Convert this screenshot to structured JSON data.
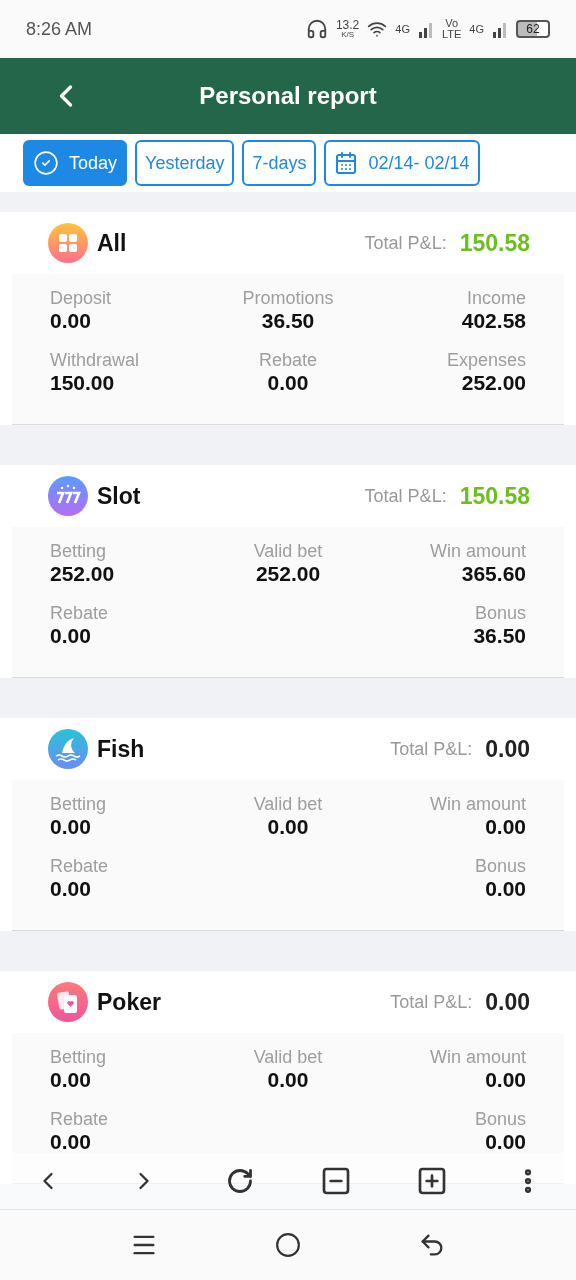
{
  "status_bar": {
    "time": "8:26 AM",
    "speed_value": "13.2",
    "speed_unit": "K/S",
    "network_1": "4G",
    "volte_top": "Vo",
    "volte_bottom": "LTE",
    "network_2": "4G",
    "battery": "62"
  },
  "header": {
    "title": "Personal report"
  },
  "filters": [
    {
      "kind": "preset",
      "label": "Today",
      "selected": true
    },
    {
      "kind": "preset",
      "label": "Yesterday",
      "selected": false
    },
    {
      "kind": "preset",
      "label": "7-days",
      "selected": false
    },
    {
      "kind": "date_range",
      "label": "02/14- 02/14",
      "selected": false
    }
  ],
  "cards": [
    {
      "name": "All",
      "kind": "grid",
      "total_label": "Total P&L:",
      "total": "150.58",
      "positive": true,
      "rows": [
        [
          {
            "label": "Deposit",
            "value": "0.00"
          },
          {
            "label": "Promotions",
            "value": "36.50"
          },
          {
            "label": "Income",
            "value": "402.58"
          }
        ],
        [
          {
            "label": "Withdrawal",
            "value": "150.00"
          },
          {
            "label": "Rebate",
            "value": "0.00"
          },
          {
            "label": "Expenses",
            "value": "252.00"
          }
        ]
      ]
    },
    {
      "name": "Slot",
      "kind": "slot",
      "total_label": "Total P&L:",
      "total": "150.58",
      "positive": true,
      "rows": [
        [
          {
            "label": "Betting",
            "value": "252.00"
          },
          {
            "label": "Valid bet",
            "value": "252.00"
          },
          {
            "label": "Win amount",
            "value": "365.60"
          }
        ],
        [
          {
            "label": "Rebate",
            "value": "0.00"
          },
          "",
          {
            "label": "Bonus",
            "value": "36.50"
          }
        ]
      ]
    },
    {
      "name": "Fish",
      "kind": "fish",
      "total_label": "Total P&L:",
      "total": "0.00",
      "positive": false,
      "rows": [
        [
          {
            "label": "Betting",
            "value": "0.00"
          },
          {
            "label": "Valid bet",
            "value": "0.00"
          },
          {
            "label": "Win amount",
            "value": "0.00"
          }
        ],
        [
          {
            "label": "Rebate",
            "value": "0.00"
          },
          "",
          {
            "label": "Bonus",
            "value": "0.00"
          }
        ]
      ]
    },
    {
      "name": "Poker",
      "kind": "poker",
      "total_label": "Total P&L:",
      "total": "0.00",
      "positive": false,
      "rows": [
        [
          {
            "label": "Betting",
            "value": "0.00"
          },
          {
            "label": "Valid bet",
            "value": "0.00"
          },
          {
            "label": "Win amount",
            "value": "0.00"
          }
        ],
        [
          {
            "label": "Rebate",
            "value": "0.00"
          },
          "",
          {
            "label": "Bonus",
            "value": "0.00"
          }
        ]
      ]
    }
  ]
}
